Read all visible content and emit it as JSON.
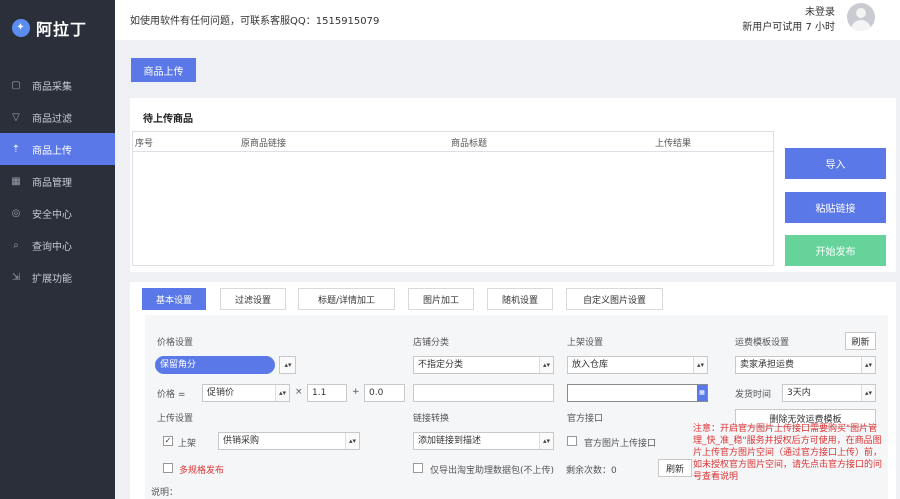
{
  "app": {
    "title": "阿拉丁"
  },
  "sidebar": {
    "items": [
      {
        "label": "商品采集",
        "icon": "box-icon"
      },
      {
        "label": "商品过滤",
        "icon": "filter-icon"
      },
      {
        "label": "商品上传",
        "icon": "upload-icon"
      },
      {
        "label": "商品管理",
        "icon": "grid-icon"
      },
      {
        "label": "安全中心",
        "icon": "shield-icon"
      },
      {
        "label": "查询中心",
        "icon": "search-icon"
      },
      {
        "label": "扩展功能",
        "icon": "extension-icon"
      }
    ]
  },
  "header": {
    "notice": "如使用软件有任何问题，可联系客服QQ：1515915079",
    "user_status": "未登录",
    "trial_text": "新用户可试用 7 小时"
  },
  "top_button": "商品上传",
  "upload_panel": {
    "title": "待上传商品",
    "columns": [
      "序号",
      "原商品链接",
      "商品标题",
      "上传结果"
    ],
    "buttons": {
      "import": "导入",
      "paste": "粘贴链接",
      "start": "开始发布"
    }
  },
  "tabs": [
    "基本设置",
    "过滤设置",
    "标题/详情加工",
    "图片加工",
    "随机设置",
    "自定义图片设置"
  ],
  "form": {
    "price_label": "价格设置",
    "price_select": "保留角分",
    "price_eq_label": "价格 =",
    "price_base": "促销价",
    "multiply": "×",
    "multiplier": "1.1",
    "plus": "+",
    "addend": "0.0",
    "shelf_label": "上传设置",
    "shelf_checkbox": "上架",
    "shelf_select": "供销采购",
    "multi_spec": "多规格发布",
    "note_label": "说明：",
    "store_cat_label": "店铺分类",
    "store_cat_select": "不指定分类",
    "link_cat_label": "链接转换",
    "link_cat_select": "添加链接到描述",
    "tb_checkbox": "仅导出淘宝助理数据包(不上传)",
    "remain_label": "剩余次数：0",
    "refresh_btn": "刷新",
    "listing_label": "上架设置",
    "listing_select": "放入仓库",
    "official_label": "官方接口",
    "official_checkbox": "官方图片上传接口",
    "freight_label": "运费模板设置",
    "freight_refresh": "刷新",
    "freight_select": "卖家承担运费",
    "ship_time_label": "发货时间",
    "ship_time_select": "3天内",
    "delete_freight_btn": "删除无效运费模板",
    "warning": "注意：开启官方图片上传接口需要购买\"图片管理_快_准_稳\"服务并授权后方可使用，在商品图片上传官方图片空间（通过官方接口上传）前，如未授权官方图片空间，请先点击官方接口的问号查看说明"
  },
  "colors": {
    "accent": "#5b78e8",
    "sidebar_bg": "#2b2f3a",
    "start_btn": "#66d39b",
    "warn": "#d33333"
  }
}
